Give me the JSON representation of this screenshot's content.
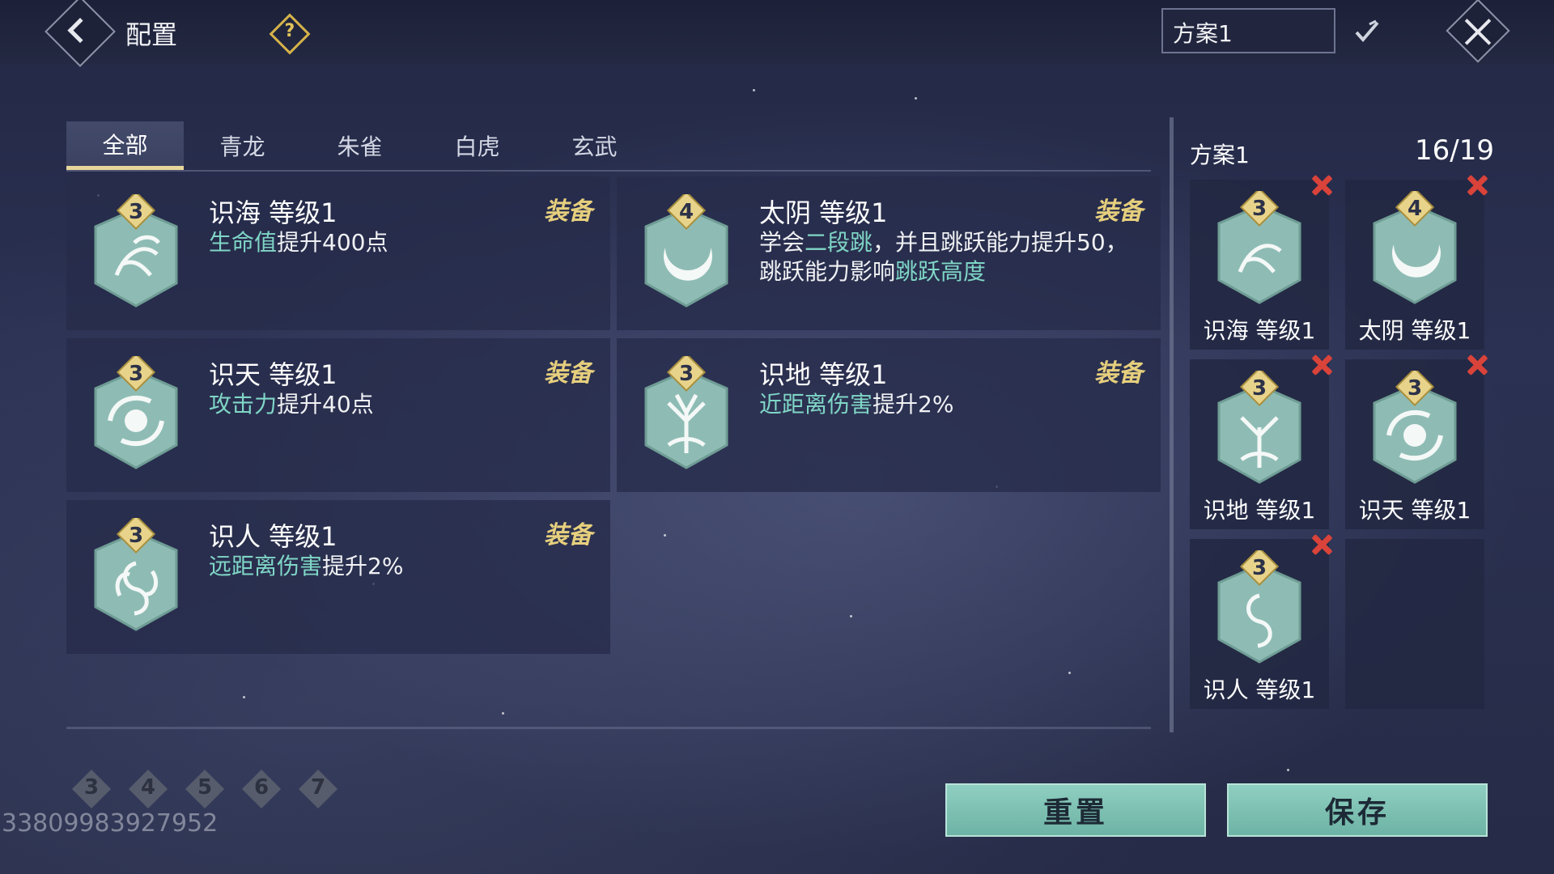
{
  "header": {
    "title": "配置",
    "scheme_name": "方案1"
  },
  "tabs": [
    {
      "label": "全部",
      "active": true
    },
    {
      "label": "青龙",
      "active": false
    },
    {
      "label": "朱雀",
      "active": false
    },
    {
      "label": "白虎",
      "active": false
    },
    {
      "label": "玄武",
      "active": false
    }
  ],
  "cards": [
    {
      "badge": "3",
      "name": "识海 等级1",
      "equip": "装备",
      "desc_pre": "",
      "desc_hl": "生命值",
      "desc_post": "提升400点",
      "icon": "wave-bird-icon"
    },
    {
      "badge": "4",
      "name": "太阴 等级1",
      "equip": "装备",
      "desc_pre": "学会",
      "desc_hl": "二段跳",
      "desc_mid": "，并且跳跃能力提升50，跳跃能力影响",
      "desc_hl2": "跳跃高度",
      "icon": "crescent-moon-icon"
    },
    {
      "badge": "3",
      "name": "识天 等级1",
      "equip": "装备",
      "desc_pre": "",
      "desc_hl": "攻击力",
      "desc_post": "提升40点",
      "icon": "sun-swirl-icon"
    },
    {
      "badge": "3",
      "name": "识地 等级1",
      "equip": "装备",
      "desc_pre": "",
      "desc_hl": "近距离伤害",
      "desc_post": "提升2%",
      "icon": "tree-icon"
    },
    {
      "badge": "3",
      "name": "识人 等级1",
      "equip": "装备",
      "desc_pre": "",
      "desc_hl": "远距离伤害",
      "desc_post": "提升2%",
      "icon": "human-swirl-icon"
    }
  ],
  "filters": [
    "3",
    "4",
    "5",
    "6",
    "7"
  ],
  "uid": "33809983927952",
  "right_panel": {
    "title": "方案1",
    "count": "16/19",
    "slots": [
      {
        "badge": "3",
        "name": "识海 等级1"
      },
      {
        "badge": "4",
        "name": "太阴 等级1"
      },
      {
        "badge": "3",
        "name": "识地 等级1"
      },
      {
        "badge": "3",
        "name": "识天 等级1"
      },
      {
        "badge": "3",
        "name": "识人 等级1"
      }
    ]
  },
  "buttons": {
    "reset": "重置",
    "save": "保存"
  },
  "colors": {
    "highlight": "#7fd6c6",
    "equip": "#e6cf7d",
    "button": "#7fc3b5",
    "remove": "#d9433a"
  }
}
